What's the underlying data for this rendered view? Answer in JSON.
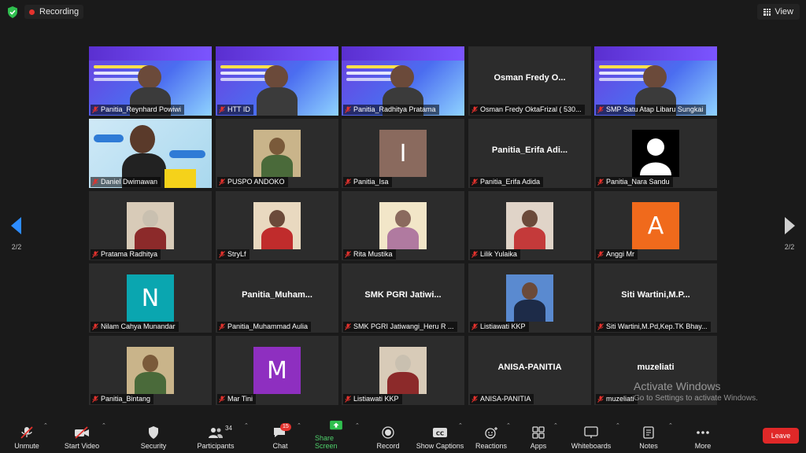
{
  "topbar": {
    "recording_label": "Recording",
    "view_label": "View"
  },
  "pager": {
    "left": "2/2",
    "right": "2/2"
  },
  "tiles": [
    {
      "name": "Panitia_Reynhard Powiwi",
      "big": "",
      "kind": "slide"
    },
    {
      "name": "HTT ID",
      "big": "",
      "kind": "slide"
    },
    {
      "name": "Panitia_Radhitya Pratama",
      "big": "",
      "kind": "slide"
    },
    {
      "name": "Osman Fredy OktaFrizal ( 530...",
      "big": "Osman Fredy O...",
      "kind": "text"
    },
    {
      "name": "SMP Satu Atap Libaru Sungkai",
      "big": "",
      "kind": "slide"
    },
    {
      "name": "Daniel Dwimawan",
      "big": "",
      "kind": "video"
    },
    {
      "name": "PUSPO ANDOKO",
      "big": "",
      "kind": "photo"
    },
    {
      "name": "Panitia_Isa",
      "big": "I",
      "kind": "avatar"
    },
    {
      "name": "Panitia_Erifa Adida",
      "big": "Panitia_Erifa Adi...",
      "kind": "text"
    },
    {
      "name": "Panitia_Nara Sandu",
      "big": "",
      "kind": "default"
    },
    {
      "name": "Pratama Radhitya",
      "big": "",
      "kind": "photo"
    },
    {
      "name": "StryLf",
      "big": "",
      "kind": "photo"
    },
    {
      "name": "Rita Mustika",
      "big": "",
      "kind": "photo"
    },
    {
      "name": "Lilik Yulaika",
      "big": "",
      "kind": "photo"
    },
    {
      "name": "Anggi Mr",
      "big": "A",
      "kind": "avatar"
    },
    {
      "name": "Nilam Cahya Munandar",
      "big": "N",
      "kind": "avatar"
    },
    {
      "name": "Panitia_Muhammad Aulia",
      "big": "Panitia_Muham...",
      "kind": "text"
    },
    {
      "name": "SMK PGRI Jatiwangi_Heru R ...",
      "big": "SMK PGRI Jatiwi...",
      "kind": "text"
    },
    {
      "name": "Listiawati KKP",
      "big": "",
      "kind": "photo"
    },
    {
      "name": "Siti Wartini,M.Pd,Kep.TK Bhay...",
      "big": "Siti Wartini,M.P...",
      "kind": "text"
    },
    {
      "name": "Panitia_Bintang",
      "big": "",
      "kind": "photo"
    },
    {
      "name": "Mar Tini",
      "big": "M",
      "kind": "avatar"
    },
    {
      "name": "Listiawati KKP",
      "big": "",
      "kind": "photo"
    },
    {
      "name": "ANISA-PANITIA",
      "big": "ANISA-PANITIA",
      "kind": "text"
    },
    {
      "name": "muzeliati",
      "big": "muzeliati",
      "kind": "text"
    }
  ],
  "toolbar": {
    "unmute": "Unmute",
    "start_video": "Start Video",
    "security": "Security",
    "participants": "Participants",
    "participants_count": "34",
    "chat": "Chat",
    "chat_badge": "15",
    "share_screen": "Share Screen",
    "record": "Record",
    "show_captions": "Show Captions",
    "reactions": "Reactions",
    "apps": "Apps",
    "whiteboards": "Whiteboards",
    "notes": "Notes",
    "more": "More",
    "leave": "Leave"
  },
  "watermark": {
    "line1": "Activate Windows",
    "line2": "Go to Settings to activate Windows."
  },
  "colors": {
    "accent_green": "#4fd06b",
    "leave_red": "#e02828",
    "avatar_I": "#8a6a5e",
    "avatar_A": "#f06a1c",
    "avatar_N": "#0aa6b0",
    "avatar_M": "#8e2fc0"
  }
}
